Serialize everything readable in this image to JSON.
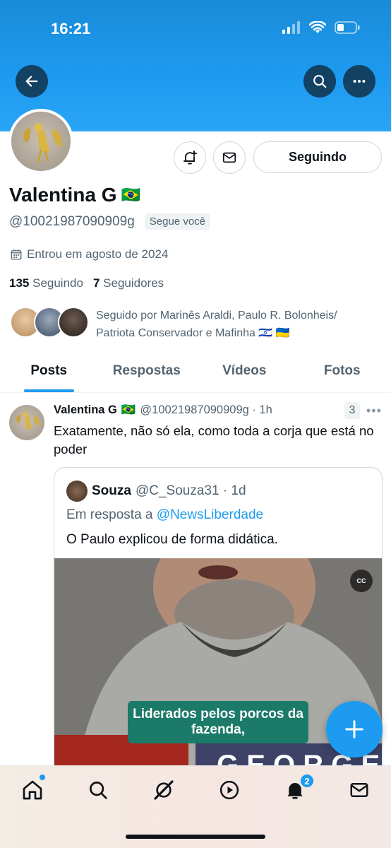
{
  "status_bar": {
    "time": "16:21"
  },
  "header": {
    "back_icon": "arrow-left-icon",
    "search_icon": "search-icon",
    "more_icon": "more-horizontal-icon"
  },
  "profile": {
    "display_name": "Valentina G",
    "name_flag": "🇧🇷",
    "handle": "@10021987090909g",
    "follows_you": "Segue você",
    "joined": "Entrou em agosto de 2024",
    "following_count": "135",
    "following_label": "Seguindo",
    "followers_count": "7",
    "followers_label": "Seguidores",
    "followed_by": "Seguido por Marinês Araldi, Paulo R. Bolonheis/ Patriota Conservador e Mafinha 🇮🇱 🇺🇦",
    "follow_button": "Seguindo"
  },
  "tabs": [
    {
      "label": "Posts",
      "active": true
    },
    {
      "label": "Respostas",
      "active": false
    },
    {
      "label": "Vídeos",
      "active": false
    },
    {
      "label": "Fotos",
      "active": false
    }
  ],
  "post": {
    "name": "Valentina G",
    "flag": "🇧🇷",
    "meta": "@10021987090909g · 1h",
    "reply_count": "3",
    "text": "Exatamente, não só ela, como toda a corja que está no poder",
    "quote": {
      "name": "Souza",
      "meta": "@C_Souza31 · 1d",
      "reply_prefix": "Em resposta a",
      "reply_handle": "@NewsLiberdade",
      "text": "O Paulo explicou de forma didática.",
      "video_caption": "Liderados pelos porcos da fazenda,",
      "cc_label": "CC"
    }
  },
  "bottom_nav": {
    "items": [
      "home-icon",
      "search-icon",
      "grok-icon",
      "play-icon",
      "bell-icon",
      "mail-icon"
    ],
    "notification_badge": "2"
  },
  "colors": {
    "accent": "#1d9bf0",
    "text": "#0f1419",
    "muted": "#536471"
  }
}
